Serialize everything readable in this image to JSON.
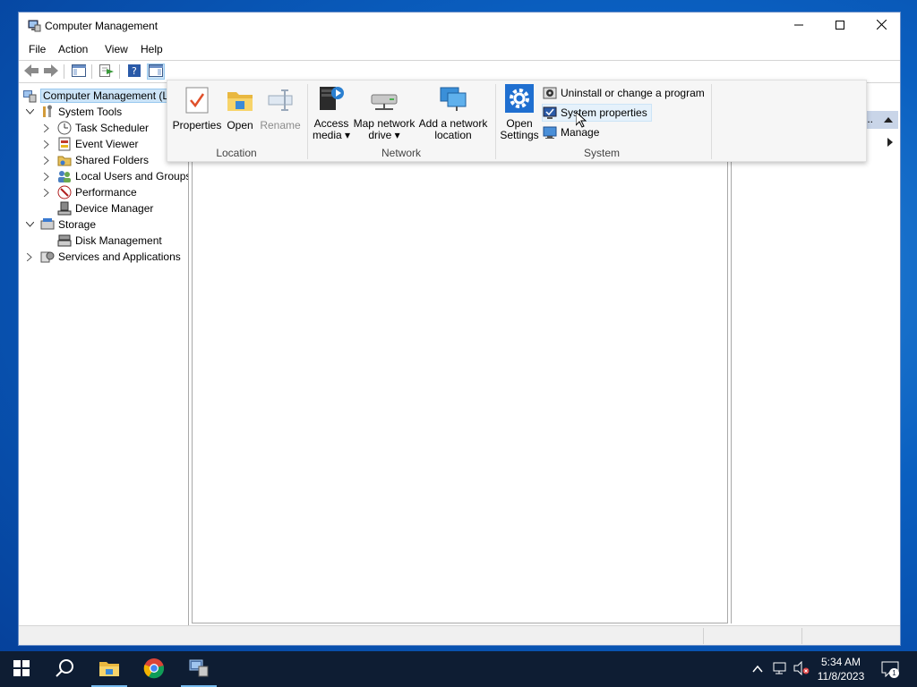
{
  "window": {
    "title": "Computer Management",
    "controls": {
      "minimize": "minimize-icon",
      "maximize": "maximize-icon",
      "close": "close-icon"
    }
  },
  "menu": [
    "File",
    "Action",
    "View",
    "Help"
  ],
  "toolbar": {
    "icons": [
      "back-arrow-icon",
      "forward-arrow-icon",
      "show-hide-tree-icon",
      "export-list-icon",
      "help-icon",
      "show-hide-action-pane-icon"
    ]
  },
  "tree": {
    "root": "Computer Management (L",
    "system_tools": "System Tools",
    "task_scheduler": "Task Scheduler",
    "event_viewer": "Event Viewer",
    "shared_folders": "Shared Folders",
    "local_users": "Local Users and Groups",
    "performance": "Performance",
    "device_manager": "Device Manager",
    "storage": "Storage",
    "disk_management": "Disk Management",
    "services": "Services and Applications"
  },
  "actions_pane": {
    "header_text": "..."
  },
  "ribbon": {
    "location": {
      "label": "Location",
      "properties": "Properties",
      "open": "Open",
      "rename": "Rename"
    },
    "network": {
      "label": "Network",
      "access_media_1": "Access",
      "access_media_2": "media ▾",
      "map_drive_1": "Map network",
      "map_drive_2": "drive ▾",
      "add_location_1": "Add a network",
      "add_location_2": "location"
    },
    "system": {
      "label": "System",
      "open_settings_1": "Open",
      "open_settings_2": "Settings",
      "uninstall": "Uninstall or change a program",
      "system_properties": "System properties",
      "manage": "Manage"
    }
  },
  "taskbar": {
    "apps": [
      "windows-start-icon",
      "search-icon",
      "file-explorer-icon",
      "chrome-icon",
      "computer-management-icon"
    ],
    "clock_time": "5:34 AM",
    "clock_date": "11/8/2023",
    "notification_count": "1"
  },
  "colors": {
    "accent": "#0078d7",
    "selection": "#cce4f7",
    "taskbar": "#0e1d33"
  }
}
